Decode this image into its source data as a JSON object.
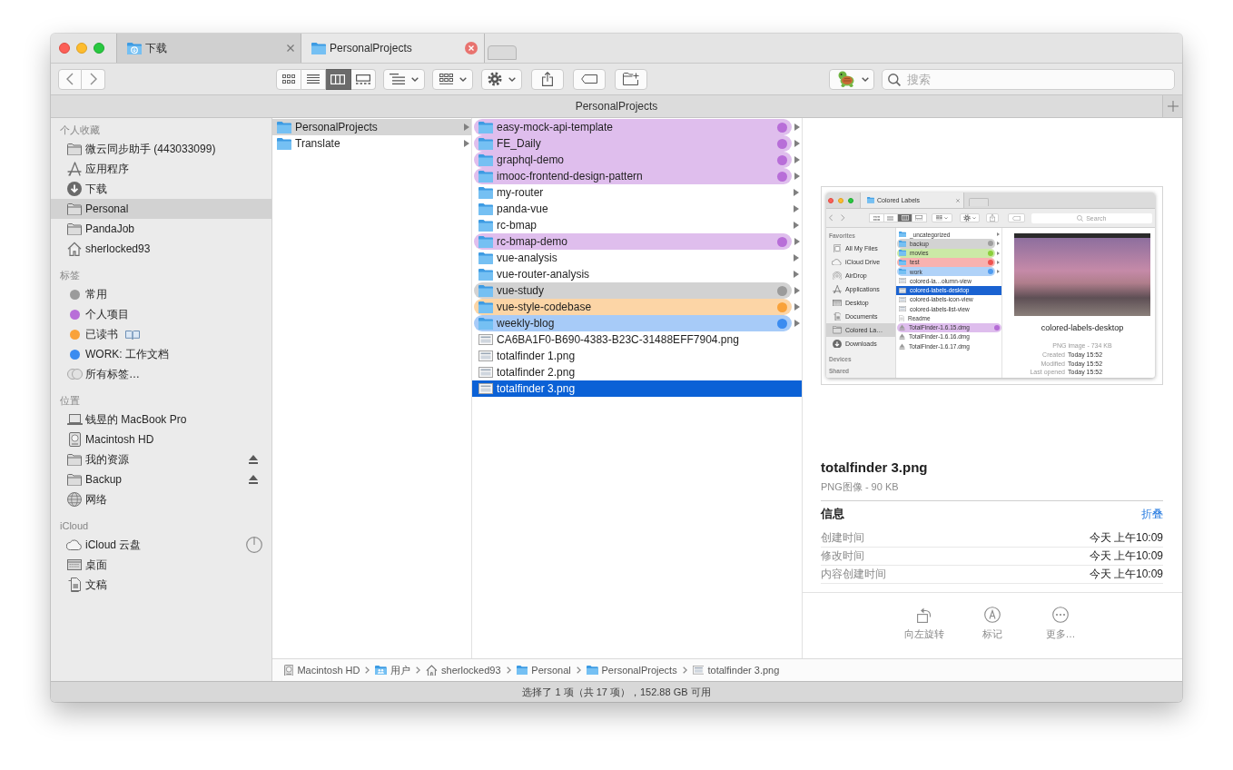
{
  "window": {
    "tabs": [
      {
        "label": "下载",
        "kind": "downloads",
        "selected": false
      },
      {
        "label": "PersonalProjects",
        "kind": "folder",
        "selected": true
      }
    ]
  },
  "toolbar": {
    "view_modes": [
      {
        "selected": false
      },
      {
        "selected": false
      },
      {
        "selected": true
      },
      {
        "selected": false
      }
    ],
    "search": {
      "placeholder": "搜索"
    }
  },
  "path_title": "PersonalProjects",
  "sidebar": {
    "sections": [
      {
        "heading": "个人收藏",
        "items": [
          {
            "label": "微云同步助手 (443033099)",
            "kind": "folder",
            "selected": false
          },
          {
            "label": "应用程序",
            "kind": "applications",
            "selected": false
          },
          {
            "label": "下载",
            "kind": "downloads",
            "selected": false
          },
          {
            "label": "Personal",
            "kind": "folder",
            "selected": true
          },
          {
            "label": "PandaJob",
            "kind": "folder",
            "selected": false
          },
          {
            "label": "sherlocked93",
            "kind": "home",
            "selected": false
          }
        ]
      },
      {
        "heading": "标签",
        "items": [
          {
            "label": "常用",
            "kind": "tag",
            "color": "#9b9b9b",
            "suffix_icon": false,
            "selected": false
          },
          {
            "label": "个人项目",
            "kind": "tag",
            "color": "#b86ed8",
            "suffix_icon": false,
            "selected": false
          },
          {
            "label": "已读书",
            "kind": "tag",
            "color": "#f9a23a",
            "suffix_icon": true,
            "selected": false
          },
          {
            "label": "WORK: 工作文档",
            "kind": "tag",
            "color": "#3b8cf0",
            "suffix_icon": false,
            "selected": false
          },
          {
            "label": "所有标签…",
            "kind": "all_tags",
            "suffix_icon": false,
            "selected": false
          }
        ]
      },
      {
        "heading": "位置",
        "items": [
          {
            "label": "钱昱的 MacBook Pro",
            "kind": "computer",
            "ejectable": false,
            "selected": false
          },
          {
            "label": "Macintosh HD",
            "kind": "disk",
            "ejectable": false,
            "selected": false
          },
          {
            "label": "我的资源",
            "kind": "folder",
            "ejectable": true,
            "selected": false
          },
          {
            "label": "Backup",
            "kind": "folder",
            "ejectable": true,
            "selected": false
          },
          {
            "label": "网络",
            "kind": "network",
            "ejectable": false,
            "selected": false
          }
        ]
      },
      {
        "heading": "iCloud",
        "items": [
          {
            "label": "iCloud 云盘",
            "kind": "cloud",
            "syncing": true,
            "selected": false
          },
          {
            "label": "桌面",
            "kind": "desktop",
            "syncing": false,
            "selected": false
          },
          {
            "label": "文稿",
            "kind": "documents",
            "syncing": false,
            "selected": false
          }
        ]
      }
    ]
  },
  "columns": [
    {
      "active": false,
      "items": [
        {
          "name": "PersonalProjects",
          "kind": "folder",
          "selected": true
        },
        {
          "name": "Translate",
          "kind": "folder",
          "selected": false
        }
      ]
    },
    {
      "active": true,
      "items": [
        {
          "name": "easy-mock-api-template",
          "kind": "folder",
          "color": "#b86ed8",
          "selected": false
        },
        {
          "name": "FE_Daily",
          "kind": "folder",
          "color": "#b86ed8",
          "selected": false
        },
        {
          "name": "graphql-demo",
          "kind": "folder",
          "color": "#b86ed8",
          "selected": false
        },
        {
          "name": "imooc-frontend-design-pattern",
          "kind": "folder",
          "color": "#b86ed8",
          "selected": false
        },
        {
          "name": "my-router",
          "kind": "folder",
          "selected": false
        },
        {
          "name": "panda-vue",
          "kind": "folder",
          "selected": false
        },
        {
          "name": "rc-bmap",
          "kind": "folder",
          "selected": false
        },
        {
          "name": "rc-bmap-demo",
          "kind": "folder",
          "color": "#b86ed8",
          "selected": false
        },
        {
          "name": "vue-analysis",
          "kind": "folder",
          "selected": false
        },
        {
          "name": "vue-router-analysis",
          "kind": "folder",
          "selected": false
        },
        {
          "name": "vue-study",
          "kind": "folder",
          "color": "#9b9b9b",
          "selected": false
        },
        {
          "name": "vue-style-codebase",
          "kind": "folder",
          "color": "#f9a23a",
          "selected": false
        },
        {
          "name": "weekly-blog",
          "kind": "folder",
          "color": "#3b8cf0",
          "selected": false
        },
        {
          "name": "CA6BA1F0-B690-4383-B23C-31488EFF7904.png",
          "kind": "image",
          "selected": false
        },
        {
          "name": "totalfinder 1.png",
          "kind": "image",
          "selected": false
        },
        {
          "name": "totalfinder 2.png",
          "kind": "image",
          "selected": false
        },
        {
          "name": "totalfinder 3.png",
          "kind": "image",
          "selected": true
        }
      ]
    }
  ],
  "preview": {
    "screenshot": {
      "tab": "Colored Labels",
      "view_modes": [
        {
          "selected": false
        },
        {
          "selected": false
        },
        {
          "selected": true
        },
        {
          "selected": false
        }
      ],
      "search": {
        "placeholder": "Search"
      },
      "sidebar": [
        {
          "heading": "Favorites",
          "items": [
            {
              "label": "All My Files",
              "kind": "all_files",
              "selected": false
            },
            {
              "label": "iCloud Drive",
              "kind": "cloud",
              "selected": false
            },
            {
              "label": "AirDrop",
              "kind": "airdrop",
              "selected": false
            },
            {
              "label": "Applications",
              "kind": "applications",
              "selected": false
            },
            {
              "label": "Desktop",
              "kind": "desktop",
              "selected": false
            },
            {
              "label": "Documents",
              "kind": "documents",
              "selected": false
            },
            {
              "label": "Colored La…",
              "kind": "folder",
              "selected": true
            },
            {
              "label": "Downloads",
              "kind": "downloads",
              "selected": false
            }
          ]
        },
        {
          "heading": "Devices"
        },
        {
          "heading": "Shared"
        }
      ],
      "files": [
        {
          "name": "_uncategorized",
          "kind": "folder",
          "selected": false
        },
        {
          "name": "backup",
          "kind": "folder",
          "color": "#9e9e9e",
          "selected": false
        },
        {
          "name": "movies",
          "kind": "folder",
          "color": "#8ccf3a",
          "selected": false
        },
        {
          "name": "test",
          "kind": "folder",
          "color": "#ef5350",
          "selected": false
        },
        {
          "name": "work",
          "kind": "folder",
          "color": "#4f9bf0",
          "selected": false
        },
        {
          "name": "colored-la…olumn-view",
          "kind": "image",
          "selected": false
        },
        {
          "name": "colored-labels-desktop",
          "kind": "image",
          "selected": true
        },
        {
          "name": "colored-labels-icon-view",
          "kind": "image",
          "selected": false
        },
        {
          "name": "colored-labels-list-view",
          "kind": "image",
          "selected": false
        },
        {
          "name": "Readme",
          "kind": "document",
          "selected": false
        },
        {
          "name": "TotalFinder-1.6.15.dmg",
          "kind": "disk_image",
          "color": "#b56cd6",
          "selected": false
        },
        {
          "name": "TotalFinder-1.6.16.dmg",
          "kind": "disk_image",
          "selected": false
        },
        {
          "name": "TotalFinder-1.6.17.dmg",
          "kind": "disk_image",
          "selected": false
        }
      ],
      "preview": {
        "name": "colored-labels-desktop",
        "subtitle": "PNG image - 734 KB",
        "rows": [
          {
            "label": "Created",
            "value": "Today 15:52"
          },
          {
            "label": "Modified",
            "value": "Today 15:52"
          },
          {
            "label": "Last opened",
            "value": "Today 15:52"
          }
        ]
      }
    },
    "name": "totalfinder 3.png",
    "subtitle": "PNG图像 - 90 KB",
    "info": {
      "heading": "信息",
      "toggle": "折叠",
      "rows": [
        {
          "label": "创建时间",
          "value": "今天 上午10:09"
        },
        {
          "label": "修改时间",
          "value": "今天 上午10:09"
        },
        {
          "label": "内容创建时间",
          "value": "今天 上午10:09"
        }
      ]
    },
    "actions": [
      {
        "label": "向左旋转",
        "kind": "rotate"
      },
      {
        "label": "标记",
        "kind": "markup"
      },
      {
        "label": "更多…",
        "kind": "more"
      }
    ]
  },
  "path_bar": [
    {
      "label": "Macintosh HD",
      "kind": "disk"
    },
    {
      "label": "用户",
      "kind": "users"
    },
    {
      "label": "sherlocked93",
      "kind": "home"
    },
    {
      "label": "Personal",
      "kind": "folder"
    },
    {
      "label": "PersonalProjects",
      "kind": "folder"
    },
    {
      "label": "totalfinder 3.png",
      "kind": "image"
    }
  ],
  "status_bar": "选择了 1 项（共 17 项），152.88 GB 可用"
}
